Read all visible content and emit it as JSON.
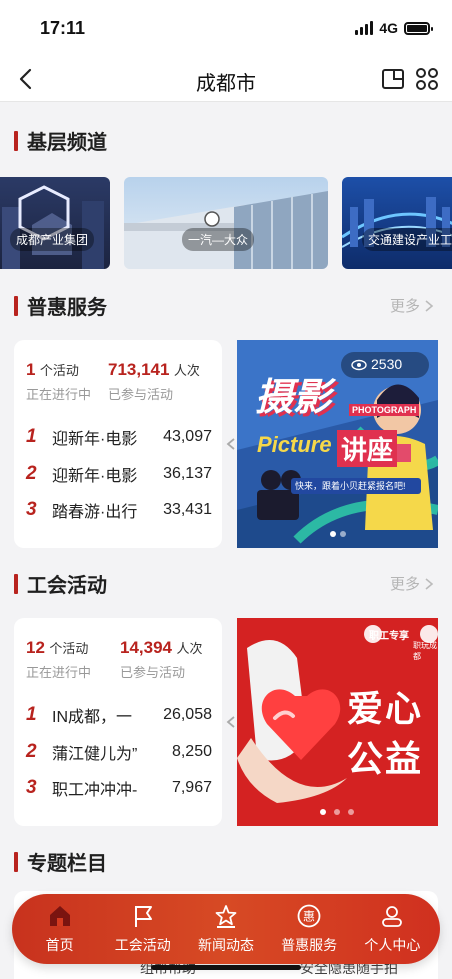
{
  "status": {
    "time": "17:11",
    "network": "4G"
  },
  "nav": {
    "title": "成都市",
    "back_icon": "chevron-left-icon",
    "tool_icons": [
      "window-icon",
      "grid-icon"
    ]
  },
  "channels": {
    "title": "基层频道",
    "items": [
      {
        "label": "成都产业集团"
      },
      {
        "label": "一汽—大众"
      },
      {
        "label": "交通建设产业工会"
      }
    ]
  },
  "benefit": {
    "title": "普惠服务",
    "more": "更多",
    "activity_count": "1",
    "activity_unit": "个活动",
    "activity_sub": "正在进行中",
    "participants": "713,141",
    "participants_unit": "人次",
    "participants_sub": "已参与活动",
    "ranking": [
      {
        "rank": "1",
        "name": "迎新年·电影",
        "value": "43,097"
      },
      {
        "rank": "2",
        "name": "迎新年·电影",
        "value": "36,137"
      },
      {
        "rank": "3",
        "name": "踏春游·出行",
        "value": "33,431"
      }
    ],
    "banner": {
      "views": "2530",
      "headline_1": "摄影",
      "headline_2": "讲座",
      "script_word": "Picture",
      "tag": "PHOTOGRAPH",
      "caption": "快来，跟着小贝赶紧报名吧!"
    }
  },
  "union": {
    "title": "工会活动",
    "more": "更多",
    "activity_count": "12",
    "activity_unit": "个活动",
    "activity_sub": "正在进行中",
    "participants": "14,394",
    "participants_unit": "人次",
    "participants_sub": "已参与活动",
    "ranking": [
      {
        "rank": "1",
        "name": "IN成都，一",
        "value": "26,058"
      },
      {
        "rank": "2",
        "name": "蒲江健儿为”",
        "value": "8,250"
      },
      {
        "rank": "3",
        "name": "职工冲冲冲-",
        "value": "7,967"
      }
    ],
    "banner": {
      "headline_1": "爱心",
      "headline_2": "公益",
      "brand_1": "职工专享",
      "brand_2": "职玩成都"
    }
  },
  "topics": {
    "title": "专题栏目"
  },
  "tabbar": {
    "items": [
      {
        "label": "首页",
        "icon": "home-icon"
      },
      {
        "label": "工会活动",
        "icon": "flag-icon"
      },
      {
        "label": "新闻动态",
        "icon": "star-icon"
      },
      {
        "label": "普惠服务",
        "icon": "benefit-icon"
      },
      {
        "label": "个人中心",
        "icon": "person-icon"
      }
    ]
  },
  "behind_tabbar": {
    "left": "组帮帮助",
    "right": "安全隐患随手拍"
  },
  "colors": {
    "accent": "#b8231e",
    "tabbar": "#d0391f"
  }
}
